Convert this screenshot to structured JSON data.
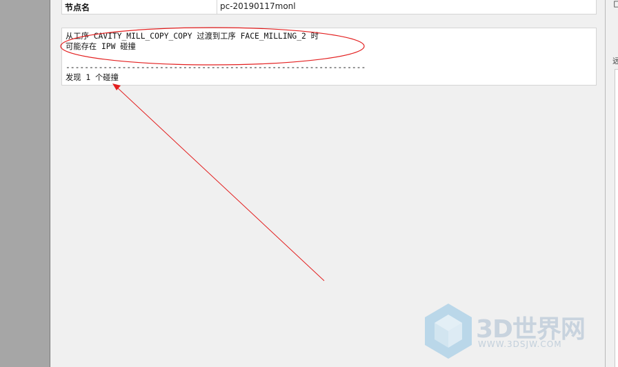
{
  "info_table": {
    "key": "节点名",
    "value": "pc-20190117monl"
  },
  "report": {
    "line1": "从工序 CAVITY_MILL_COPY_COPY 过渡到工序 FACE_MILLING_2 时",
    "line2": "可能存在 IPW 碰撞",
    "separator": "----------------------------------------------------------------",
    "line3": "发现 1 个碰撞"
  },
  "right_edge": {
    "glyph_top": "匚",
    "glyph_mid": "远"
  },
  "watermark": {
    "brand": "3D世界网",
    "url": "WWW.3DSJW.COM"
  },
  "colors": {
    "annotation": "#e31e1e",
    "gutter": "#a6a6a6",
    "panel": "#f0f0f0"
  }
}
